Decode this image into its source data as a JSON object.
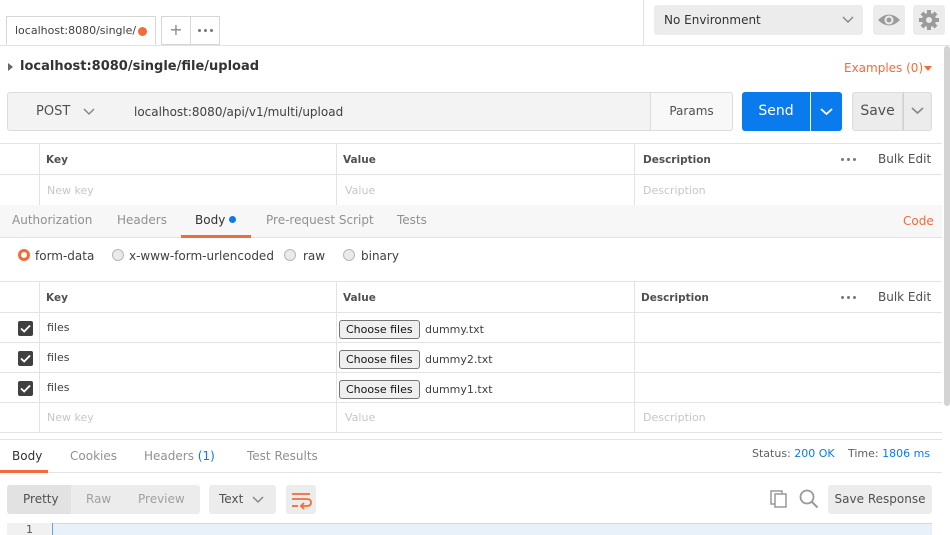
{
  "tabs": {
    "active_label": "localhost:8080/single/"
  },
  "environment": {
    "selected": "No Environment"
  },
  "request": {
    "title": "localhost:8080/single/file/upload",
    "examples": "Examples (0)",
    "method": "POST",
    "url": "localhost:8080/api/v1/multi/upload",
    "params_label": "Params",
    "send_label": "Send",
    "save_label": "Save"
  },
  "params_table": {
    "headers": {
      "key": "Key",
      "value": "Value",
      "description": "Description",
      "bulk": "Bulk Edit"
    },
    "placeholders": {
      "key": "New key",
      "value": "Value",
      "description": "Description"
    }
  },
  "request_tabs": {
    "authorization": "Authorization",
    "headers": "Headers",
    "body": "Body",
    "prerequest": "Pre-request Script",
    "tests": "Tests",
    "code": "Code"
  },
  "body_modes": {
    "form_data": "form-data",
    "urlencoded": "x-www-form-urlencoded",
    "raw": "raw",
    "binary": "binary"
  },
  "form_table": {
    "headers": {
      "key": "Key",
      "value": "Value",
      "description": "Description",
      "bulk": "Bulk Edit"
    },
    "rows": [
      {
        "key": "files",
        "button": "Choose files",
        "file": "dummy.txt"
      },
      {
        "key": "files",
        "button": "Choose files",
        "file": "dummy2.txt"
      },
      {
        "key": "files",
        "button": "Choose files",
        "file": "dummy1.txt"
      }
    ],
    "placeholders": {
      "key": "New key",
      "value": "Value",
      "description": "Description"
    }
  },
  "response": {
    "tabs": {
      "body": "Body",
      "cookies": "Cookies",
      "headers": "Headers",
      "headers_count": "(1)",
      "tests": "Test Results"
    },
    "status_label": "Status:",
    "status_value": "200 OK",
    "time_label": "Time:",
    "time_value": "1806 ms",
    "formats": {
      "pretty": "Pretty",
      "raw": "Raw",
      "preview": "Preview"
    },
    "type": "Text",
    "save_label": "Save Response",
    "line_number": "1"
  },
  "colors": {
    "accent": "#f26b3a",
    "primary": "#097bed"
  }
}
